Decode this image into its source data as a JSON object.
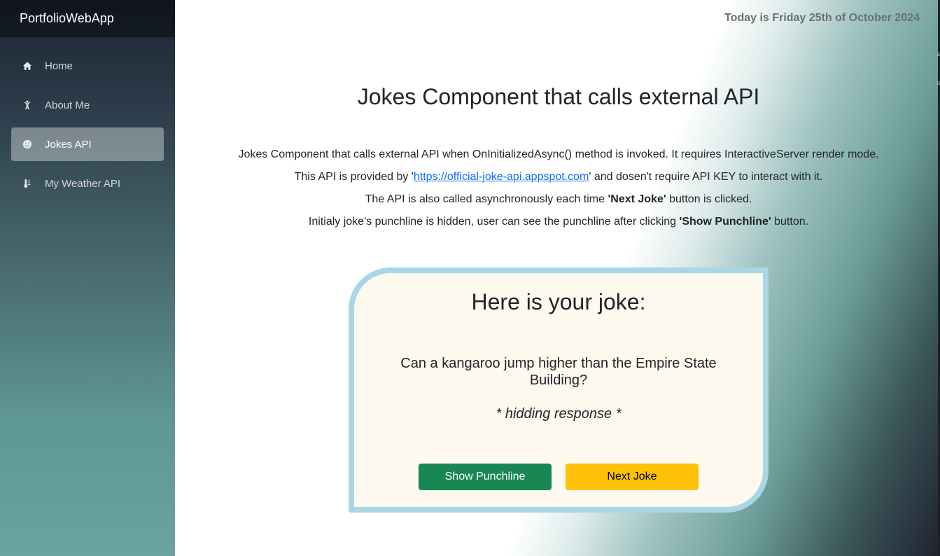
{
  "app": {
    "brand": "PortfolioWebApp"
  },
  "sidebar": {
    "items": [
      {
        "label": "Home",
        "icon": "home-icon",
        "active": false
      },
      {
        "label": "About Me",
        "icon": "person-icon",
        "active": false
      },
      {
        "label": "Jokes API",
        "icon": "smiley-icon",
        "active": true
      },
      {
        "label": "My Weather API",
        "icon": "thermometer-icon",
        "active": false
      }
    ]
  },
  "header": {
    "date": "Today is Friday 25th of October 2024"
  },
  "main": {
    "title": "Jokes Component that calls external API",
    "description": {
      "line1": "Jokes Component that calls external API when OnInitializedAsync() method is invoked. It requires InteractiveServer render mode.",
      "line2_prefix": "This API is provided by '",
      "line2_link": "https://official-joke-api.appspot.com",
      "line2_suffix": "' and dosen't require API KEY to interact with it.",
      "line3_prefix": "The API is also called asynchronously each time ",
      "line3_bold": "'Next Joke'",
      "line3_suffix": " button is clicked.",
      "line4_prefix": "Initialy joke's punchline is hidden, user can see the punchline after clicking ",
      "line4_bold": "'Show Punchline'",
      "line4_suffix": " button."
    }
  },
  "joke_card": {
    "title": "Here is your joke:",
    "setup": "Can a kangaroo jump higher than the Empire State Building?",
    "punchline": "* hidding response *",
    "show_punchline_label": "Show Punchline",
    "next_joke_label": "Next Joke"
  },
  "colors": {
    "accent_border": "#a9d6e5",
    "card_bg": "#fdf9ee",
    "btn_success": "#198754",
    "btn_warning": "#ffc107",
    "link": "#0d6efd"
  }
}
